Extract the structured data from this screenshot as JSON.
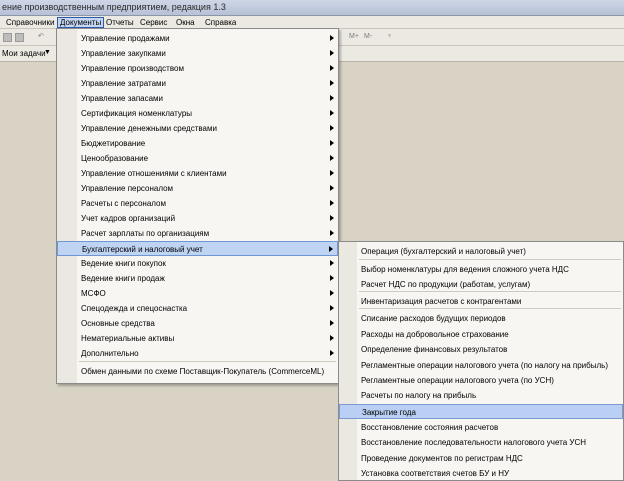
{
  "window": {
    "title": "ение производственным предприятием, редакция 1.3"
  },
  "menubar": {
    "items": [
      {
        "label": "Справочники"
      },
      {
        "label": "Документы"
      },
      {
        "label": "Отчеты"
      },
      {
        "label": "Сервис"
      },
      {
        "label": "Окна"
      },
      {
        "label": "Справка"
      }
    ]
  },
  "toolbar": {
    "mplus": "M+",
    "mminus": "M-"
  },
  "tasks": {
    "label": "Мои задачи",
    "dropdown": "▼"
  },
  "documents_menu": {
    "items": [
      {
        "label": "Управление продажами",
        "has_submenu": true
      },
      {
        "label": "Управление закупками",
        "has_submenu": true
      },
      {
        "label": "Управление производством",
        "has_submenu": true
      },
      {
        "label": "Управление затратами",
        "has_submenu": true
      },
      {
        "label": "Управление запасами",
        "has_submenu": true
      },
      {
        "label": "Сертификация номенклатуры",
        "has_submenu": true
      },
      {
        "label": "Управление денежными средствами",
        "has_submenu": true
      },
      {
        "label": "Бюджетирование",
        "has_submenu": true
      },
      {
        "label": "Ценообразование",
        "has_submenu": true
      },
      {
        "label": "Управление отношениями с клиентами",
        "has_submenu": true
      },
      {
        "label": "Управление персоналом",
        "has_submenu": true
      },
      {
        "label": "Расчеты с персоналом",
        "has_submenu": true
      },
      {
        "label": "Учет кадров организаций",
        "has_submenu": true
      },
      {
        "label": "Расчет зарплаты по организациям",
        "has_submenu": true
      },
      {
        "label": "Бухгалтерский и налоговый учет",
        "has_submenu": true,
        "highlighted": true
      },
      {
        "label": "Ведение книги покупок",
        "has_submenu": true
      },
      {
        "label": "Ведение книги продаж",
        "has_submenu": true
      },
      {
        "label": "МСФО",
        "has_submenu": true
      },
      {
        "label": "Спецодежда и спецоснастка",
        "has_submenu": true
      },
      {
        "label": "Основные средства",
        "has_submenu": true
      },
      {
        "label": "Нематериальные активы",
        "has_submenu": true
      },
      {
        "label": "Дополнительно",
        "has_submenu": true
      },
      {
        "label": "Обмен данными по схеме Поставщик-Покупатель (CommerceML)",
        "has_submenu": false
      }
    ]
  },
  "accounting_submenu": {
    "items": [
      {
        "label": "Операция (бухгалтерский и налоговый учет)"
      },
      {
        "label": "Выбор номенклатуры для ведения сложного учета НДС"
      },
      {
        "label": "Расчет НДС по продукции (работам, услугам)"
      },
      {
        "label": "Инвентаризация расчетов с контрагентами"
      },
      {
        "label": "Списание расходов будущих периодов"
      },
      {
        "label": "Расходы на добровольное страхование"
      },
      {
        "label": "Определение финансовых результатов"
      },
      {
        "label": "Регламентные операции налогового учета (по налогу на прибыль)"
      },
      {
        "label": "Регламентные операции налогового учета (по УСН)"
      },
      {
        "label": "Расчеты по налогу на прибыль"
      },
      {
        "label": "Закрытие года",
        "highlighted": true
      },
      {
        "label": "Восстановление состояния расчетов"
      },
      {
        "label": "Восстановление последовательности налогового учета УСН"
      },
      {
        "label": "Проведение документов по регистрам НДС"
      },
      {
        "label": "Установка соответствия счетов БУ и НУ"
      }
    ]
  }
}
